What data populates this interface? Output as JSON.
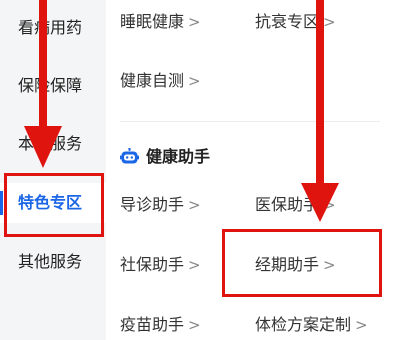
{
  "sidebar": {
    "items": [
      {
        "label": "看病用药"
      },
      {
        "label": "保险保障"
      },
      {
        "label": "本地服务"
      },
      {
        "label": "特色专区",
        "active": true
      },
      {
        "label": "其他服务"
      }
    ]
  },
  "main": {
    "top_items": [
      {
        "label": "睡眠健康"
      },
      {
        "label": "抗衰专区"
      },
      {
        "label": "健康自测"
      }
    ],
    "section": {
      "icon": "robot-icon",
      "title": "健康助手",
      "items": [
        {
          "label": "导诊助手"
        },
        {
          "label": "医保助手"
        },
        {
          "label": "社保助手"
        },
        {
          "label": "经期助手"
        },
        {
          "label": "疫苗助手"
        },
        {
          "label": "体检方案定制"
        }
      ]
    }
  },
  "colors": {
    "accent": "#1a66e6",
    "highlight": "#e0140f",
    "sidebar_bg": "#f4f5f7"
  }
}
